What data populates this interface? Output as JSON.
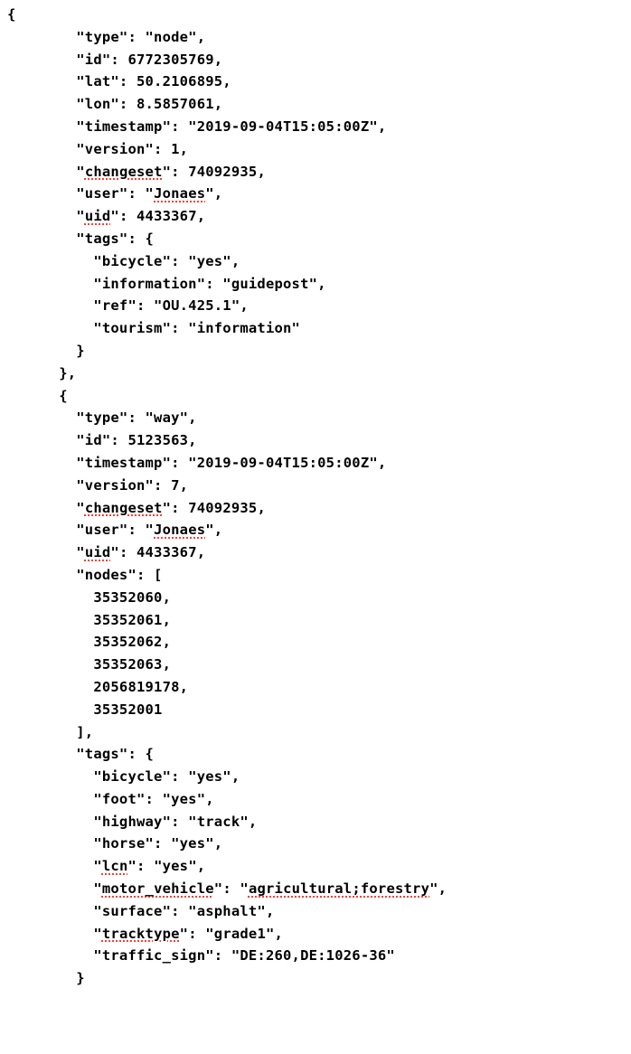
{
  "lines": [
    {
      "indent": 0,
      "segments": [
        {
          "t": "{"
        }
      ]
    },
    {
      "indent": 3,
      "segments": [
        {
          "t": "\"type\": \"node\","
        }
      ]
    },
    {
      "indent": 3,
      "segments": [
        {
          "t": "\"id\": 6772305769,"
        }
      ]
    },
    {
      "indent": 3,
      "segments": [
        {
          "t": "\"lat\": 50.2106895,"
        }
      ]
    },
    {
      "indent": 3,
      "segments": [
        {
          "t": "\"lon\": 8.5857061,"
        }
      ]
    },
    {
      "indent": 3,
      "segments": [
        {
          "t": "\"timestamp\": \"2019-09-04T15:05:00Z\","
        }
      ]
    },
    {
      "indent": 3,
      "segments": [
        {
          "t": "\"version\": 1,"
        }
      ]
    },
    {
      "indent": 3,
      "segments": [
        {
          "t": "\""
        },
        {
          "t": "changeset",
          "u": true
        },
        {
          "t": "\": 74092935,"
        }
      ]
    },
    {
      "indent": 3,
      "segments": [
        {
          "t": "\"user\": \""
        },
        {
          "t": "Jonaes",
          "u": true
        },
        {
          "t": "\","
        }
      ]
    },
    {
      "indent": 3,
      "segments": [
        {
          "t": "\""
        },
        {
          "t": "uid",
          "u": true
        },
        {
          "t": "\": 4433367,"
        }
      ]
    },
    {
      "indent": 3,
      "segments": [
        {
          "t": "\"tags\": {"
        }
      ]
    },
    {
      "indent": 4,
      "segments": [
        {
          "t": "\"bicycle\": \"yes\","
        }
      ]
    },
    {
      "indent": 4,
      "segments": [
        {
          "t": "\"information\": \"guidepost\","
        }
      ]
    },
    {
      "indent": 4,
      "segments": [
        {
          "t": "\"ref\": \"OU.425.1\","
        }
      ]
    },
    {
      "indent": 4,
      "segments": [
        {
          "t": "\"tourism\": \"information\""
        }
      ]
    },
    {
      "indent": 3,
      "segments": [
        {
          "t": "}"
        }
      ]
    },
    {
      "indent": 2,
      "segments": [
        {
          "t": "},"
        }
      ]
    },
    {
      "indent": 2,
      "segments": [
        {
          "t": "{"
        }
      ]
    },
    {
      "indent": 3,
      "segments": [
        {
          "t": "\"type\": \"way\","
        }
      ]
    },
    {
      "indent": 3,
      "segments": [
        {
          "t": "\"id\": 5123563,"
        }
      ]
    },
    {
      "indent": 3,
      "segments": [
        {
          "t": "\"timestamp\": \"2019-09-04T15:05:00Z\","
        }
      ]
    },
    {
      "indent": 3,
      "segments": [
        {
          "t": "\"version\": 7,"
        }
      ]
    },
    {
      "indent": 3,
      "segments": [
        {
          "t": "\""
        },
        {
          "t": "changeset",
          "u": true
        },
        {
          "t": "\": 74092935,"
        }
      ]
    },
    {
      "indent": 3,
      "segments": [
        {
          "t": "\"user\": \""
        },
        {
          "t": "Jonaes",
          "u": true
        },
        {
          "t": "\","
        }
      ]
    },
    {
      "indent": 3,
      "segments": [
        {
          "t": "\""
        },
        {
          "t": "uid",
          "u": true
        },
        {
          "t": "\": 4433367,"
        }
      ]
    },
    {
      "indent": 3,
      "segments": [
        {
          "t": "\"nodes\": ["
        }
      ]
    },
    {
      "indent": 4,
      "segments": [
        {
          "t": "35352060,"
        }
      ]
    },
    {
      "indent": 4,
      "segments": [
        {
          "t": "35352061,"
        }
      ]
    },
    {
      "indent": 4,
      "segments": [
        {
          "t": "35352062,"
        }
      ]
    },
    {
      "indent": 4,
      "segments": [
        {
          "t": "35352063,"
        }
      ]
    },
    {
      "indent": 4,
      "segments": [
        {
          "t": "2056819178,"
        }
      ]
    },
    {
      "indent": 4,
      "segments": [
        {
          "t": "35352001"
        }
      ]
    },
    {
      "indent": 3,
      "segments": [
        {
          "t": "],"
        }
      ]
    },
    {
      "indent": 3,
      "segments": [
        {
          "t": "\"tags\": {"
        }
      ]
    },
    {
      "indent": 4,
      "segments": [
        {
          "t": "\"bicycle\": \"yes\","
        }
      ]
    },
    {
      "indent": 4,
      "segments": [
        {
          "t": "\"foot\": \"yes\","
        }
      ]
    },
    {
      "indent": 4,
      "segments": [
        {
          "t": "\"highway\": \"track\","
        }
      ]
    },
    {
      "indent": 4,
      "segments": [
        {
          "t": "\"horse\": \"yes\","
        }
      ]
    },
    {
      "indent": 4,
      "segments": [
        {
          "t": "\""
        },
        {
          "t": "lcn",
          "u": true
        },
        {
          "t": "\": \"yes\","
        }
      ]
    },
    {
      "indent": 4,
      "segments": [
        {
          "t": "\""
        },
        {
          "t": "motor_vehicle",
          "u": true
        },
        {
          "t": "\": \""
        },
        {
          "t": "agricultural;forestry",
          "u": true
        },
        {
          "t": "\","
        }
      ]
    },
    {
      "indent": 4,
      "segments": [
        {
          "t": "\"surface\": \"asphalt\","
        }
      ]
    },
    {
      "indent": 4,
      "segments": [
        {
          "t": "\""
        },
        {
          "t": "tracktype",
          "u": true
        },
        {
          "t": "\": \"grade1\","
        }
      ]
    },
    {
      "indent": 4,
      "segments": [
        {
          "t": "\"traffic_sign\": \"DE:260,DE:1026-36\""
        }
      ]
    },
    {
      "indent": 3,
      "segments": [
        {
          "t": "}"
        }
      ]
    }
  ],
  "indentUnits": {
    "0": "",
    "2": "      ",
    "3": "        ",
    "4": "          "
  }
}
